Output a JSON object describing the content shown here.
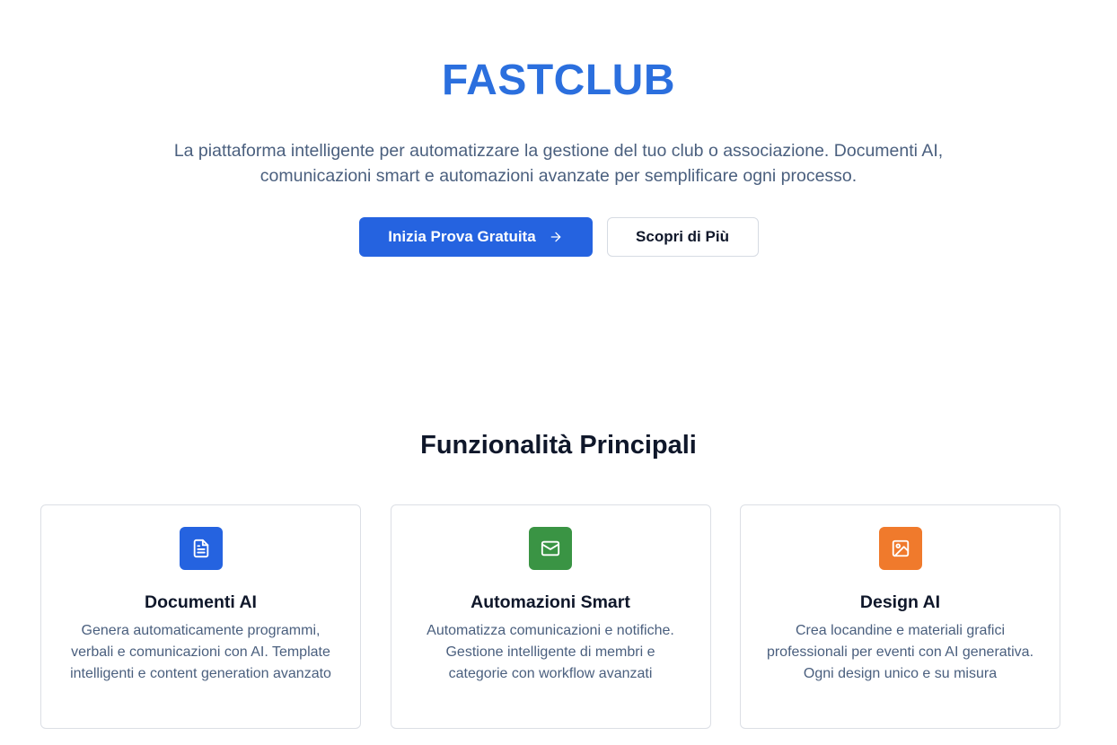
{
  "hero": {
    "brand": "FASTCLUB",
    "tagline": "La piattaforma intelligente per automatizzare la gestione del tuo club o associazione. Documenti AI, comunicazioni smart e automazioni avanzate per semplificare ogni processo.",
    "primary_cta": "Inizia Prova Gratuita",
    "primary_cta_icon": "arrow-right-icon",
    "secondary_cta": "Scopri di Più"
  },
  "features": {
    "title": "Funzionalità Principali",
    "cards": [
      {
        "title": "Documenti AI",
        "description": "Genera automaticamente programmi, verbali e comunicazioni con AI. Template intelligenti e content generation avanzato",
        "icon": "document-icon",
        "color": "#2563e0"
      },
      {
        "title": "Automazioni Smart",
        "description": "Automatizza comunicazioni e notifiche. Gestione intelligente di membri e categorie con workflow avanzati",
        "icon": "mail-icon",
        "color": "#3a9444"
      },
      {
        "title": "Design AI",
        "description": "Crea locandine e materiali grafici professionali per eventi con AI generativa. Ogni design unico e su misura",
        "icon": "image-icon",
        "color": "#f07a2c"
      }
    ]
  },
  "colors": {
    "brand": "#2b6fde",
    "primary_button": "#2563e0",
    "body_text": "#4a5f7e",
    "heading": "#0f172a"
  }
}
